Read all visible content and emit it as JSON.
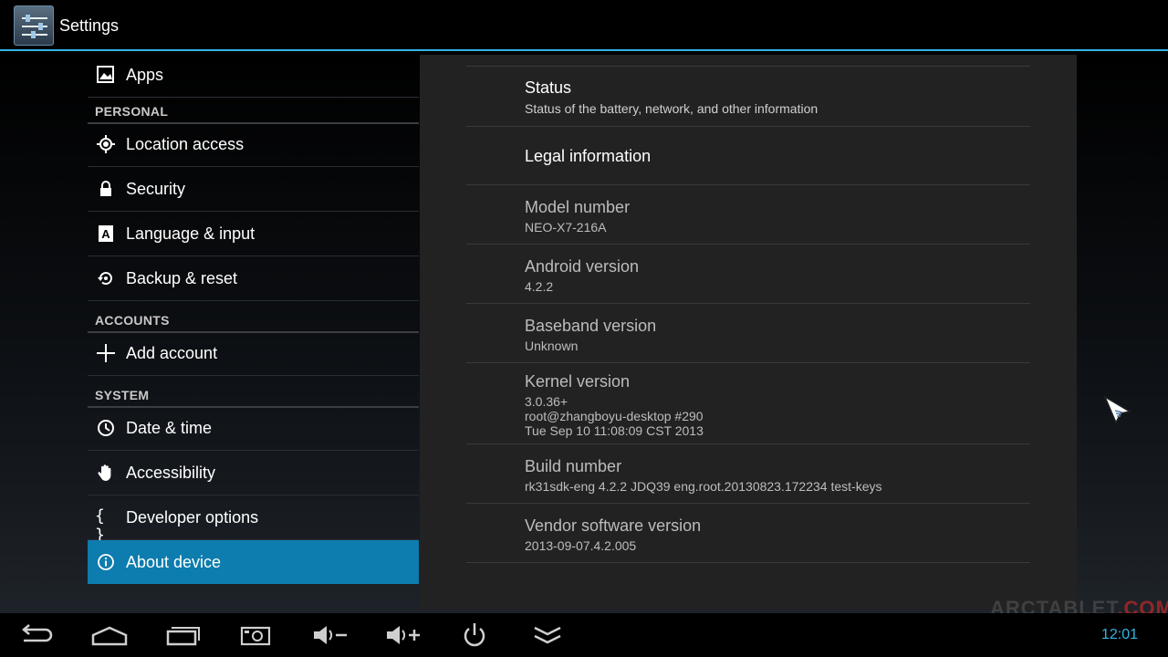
{
  "action_bar": {
    "title": "Settings",
    "icon": "settings-sliders-icon"
  },
  "left_list": {
    "apps": "Apps",
    "personal_header": "PERSONAL",
    "location": "Location access",
    "security": "Security",
    "language": "Language & input",
    "backup": "Backup & reset",
    "accounts_header": "ACCOUNTS",
    "add_account": "Add account",
    "system_header": "SYSTEM",
    "date_time": "Date & time",
    "accessibility": "Accessibility",
    "developer": "Developer options",
    "about": "About device"
  },
  "about": {
    "status_title": "Status",
    "status_sub": "Status of the battery, network, and other information",
    "legal_title": "Legal information",
    "model_title": "Model number",
    "model_value": "NEO-X7-216A",
    "android_title": "Android version",
    "android_value": "4.2.2",
    "baseband_title": "Baseband version",
    "baseband_value": "Unknown",
    "kernel_title": "Kernel version",
    "kernel_line1": "3.0.36+",
    "kernel_line2": "root@zhangboyu-desktop #290",
    "kernel_line3": "Tue Sep 10 11:08:09 CST 2013",
    "build_title": "Build number",
    "build_value": "rk31sdk-eng 4.2.2 JDQ39 eng.root.20130823.172234 test-keys",
    "vendor_title": "Vendor software version",
    "vendor_value": "2013-09-07.4.2.005"
  },
  "watermark": {
    "main": "ARCTABLET",
    "suffix": ".COM"
  },
  "nav_bar": {
    "buttons": [
      "back-icon",
      "home-icon",
      "recent-apps-icon",
      "screenshot-icon",
      "volume-down-icon",
      "volume-up-icon",
      "power-icon",
      "hide-bar-icon"
    ],
    "clock": "12:01"
  },
  "colors": {
    "accent": "#33b5e5",
    "selected": "#0d7cae",
    "panel": "#222222"
  }
}
